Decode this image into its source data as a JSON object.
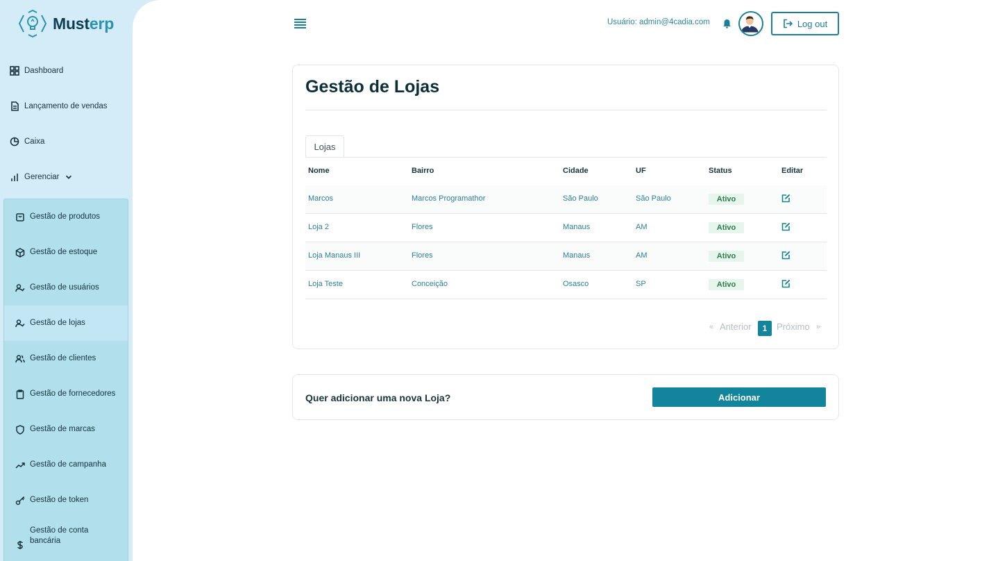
{
  "brand": {
    "name_main": "Must",
    "name_accent": "erp",
    "logo_icon": "lightbulb-logo-icon"
  },
  "sidebar": {
    "items": [
      {
        "label": "Dashboard",
        "icon": "grid-icon"
      },
      {
        "label": "Lançamento de vendas",
        "icon": "document-icon"
      },
      {
        "label": "Caixa",
        "icon": "pie-chart-icon"
      },
      {
        "label": "Gerenciar",
        "icon": "bar-chart-icon"
      }
    ],
    "submenu": [
      {
        "label": "Gestão de produtos",
        "icon": "shopping-bag-icon"
      },
      {
        "label": "Gestão de estoque",
        "icon": "box-icon"
      },
      {
        "label": "Gestão de usuários",
        "icon": "user-check-icon"
      },
      {
        "label": "Gestão de lojas",
        "icon": "user-check-icon",
        "active": true
      },
      {
        "label": "Gestão de clientes",
        "icon": "users-icon"
      },
      {
        "label": "Gestão de fornecedores",
        "icon": "clipboard-icon"
      },
      {
        "label": "Gestão de marcas",
        "icon": "shield-icon"
      },
      {
        "label": "Gestão de campanha",
        "icon": "trending-up-icon"
      },
      {
        "label": "Gestão de token",
        "icon": "key-icon"
      },
      {
        "label": "Gestão de conta bancária",
        "icon": "dollar-icon"
      }
    ]
  },
  "header": {
    "user_label": "Usuário: admin@4cadia.com",
    "logout_label": "Log out"
  },
  "page": {
    "title": "Gestão de Lojas",
    "tab": "Lojas",
    "columns": [
      "Nome",
      "Bairro",
      "Cidade",
      "UF",
      "Status",
      "Editar"
    ],
    "rows": [
      {
        "nome": "Marcos",
        "bairro": "Marcos Programathor",
        "cidade": "São Paulo",
        "uf": "São Paulo",
        "status": "Ativo"
      },
      {
        "nome": "Loja 2",
        "bairro": "Flores",
        "cidade": "Manaus",
        "uf": "AM",
        "status": "Ativo"
      },
      {
        "nome": "Loja Manaus III",
        "bairro": "Flores",
        "cidade": "Manaus",
        "uf": "AM",
        "status": "Ativo"
      },
      {
        "nome": "Loja Teste",
        "bairro": "Conceição",
        "cidade": "Osasco",
        "uf": "SP",
        "status": "Ativo"
      }
    ],
    "pagination": {
      "first": "«",
      "prev": "Anterior",
      "current": "1",
      "next": "Próximo",
      "last": "»"
    }
  },
  "add_card": {
    "question": "Quer adicionar uma nova Loja?",
    "button": "Adicionar"
  },
  "colors": {
    "primary": "#12849b",
    "sidebar": "#d3ecf8",
    "submenu": "#b1dfeb",
    "active_badge_bg": "#e6f6ec"
  }
}
